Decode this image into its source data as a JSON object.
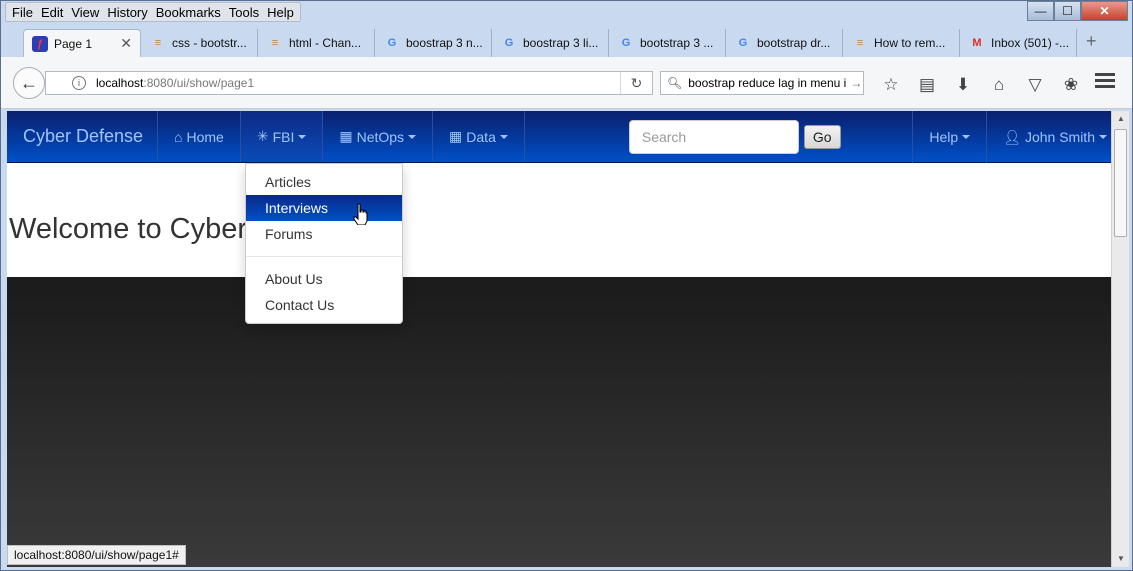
{
  "menubar": [
    "File",
    "Edit",
    "View",
    "History",
    "Bookmarks",
    "Tools",
    "Help"
  ],
  "window_controls": {
    "minimize": "—",
    "maximize": "☐",
    "close": "✕"
  },
  "tabs": [
    {
      "label": "Page 1",
      "icon": "page-icon",
      "active": true
    },
    {
      "label": "css - bootstr...",
      "icon": "stackoverflow-icon"
    },
    {
      "label": "html - Chan...",
      "icon": "stackoverflow-icon"
    },
    {
      "label": "boostrap 3 n...",
      "icon": "google-icon"
    },
    {
      "label": "boostrap 3 li...",
      "icon": "google-icon"
    },
    {
      "label": "bootstrap 3 ...",
      "icon": "google-icon"
    },
    {
      "label": "bootstrap dr...",
      "icon": "google-icon"
    },
    {
      "label": "How to rem...",
      "icon": "stackoverflow-icon"
    },
    {
      "label": "Inbox (501) -...",
      "icon": "gmail-icon"
    }
  ],
  "tab_close": "✕",
  "new_tab": "+",
  "urlbar": {
    "host": "localhost",
    "path": ":8080/ui/show/page1"
  },
  "searchbar": {
    "value": "boostrap reduce lag in menu i"
  },
  "site": {
    "brand": "Cyber Defense",
    "nav": {
      "home": "Home",
      "fbi": "FBI",
      "netops": "NetOps",
      "data": "Data"
    },
    "search_placeholder": "Search",
    "go": "Go",
    "help": "Help",
    "user": "John Smith",
    "welcome": "Welcome to Cyber Defense",
    "dropdown": [
      "Articles",
      "Interviews",
      "Forums",
      "About Us",
      "Contact Us"
    ]
  },
  "status_url": "localhost:8080/ui/show/page1#",
  "colors": {
    "nav_top": "#0a1f6e",
    "nav_bottom": "#0050c8",
    "nav_text": "#9fc3ff"
  }
}
